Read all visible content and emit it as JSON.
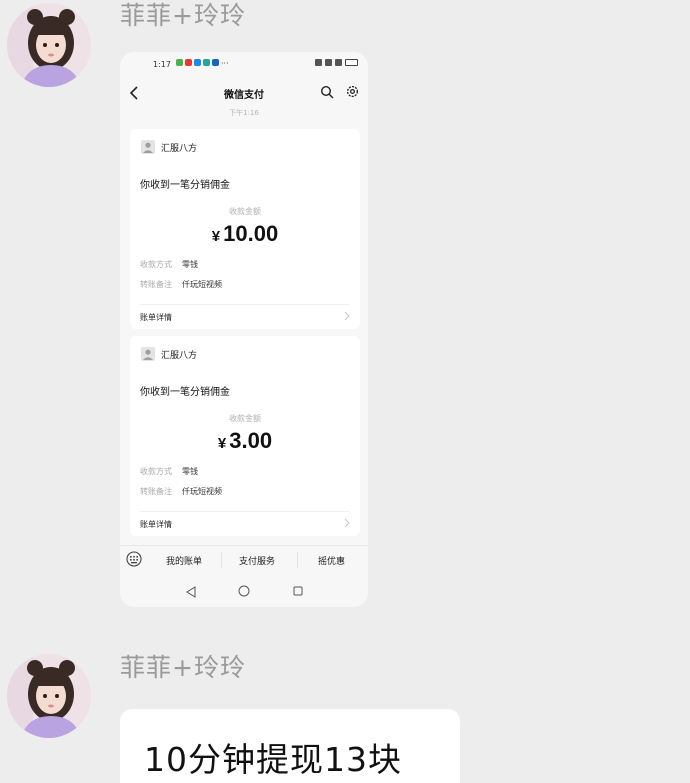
{
  "messages": [
    {
      "sender": "菲菲+玲玲",
      "type": "image"
    },
    {
      "sender": "菲菲+玲玲",
      "type": "text",
      "text": "10分钟提现13块"
    }
  ],
  "screenshot": {
    "status_time": "1:17",
    "status_dots": "···",
    "status_icon_colors": [
      "#4caf50",
      "#e53935",
      "#1e88e5",
      "#26a69a",
      "#1565c0"
    ],
    "nav_title": "微信支付",
    "timestamp": "下午1:16",
    "cards": [
      {
        "merchant": "汇服八方",
        "title": "你收到一笔分销佣金",
        "amount_label": "收款金额",
        "currency": "¥",
        "amount": "10.00",
        "method_label": "收款方式",
        "method_value": "零钱",
        "note_label": "转账备注",
        "note_value": "仟玩短视频",
        "detail_label": "账单详情"
      },
      {
        "merchant": "汇服八方",
        "title": "你收到一笔分销佣金",
        "amount_label": "收款金额",
        "currency": "¥",
        "amount": "3.00",
        "method_label": "收款方式",
        "method_value": "零钱",
        "note_label": "转账备注",
        "note_value": "仟玩短视频",
        "detail_label": "账单详情"
      }
    ],
    "bottom_menu": [
      "我的账单",
      "支付服务",
      "摇优惠"
    ]
  },
  "icons": {
    "back": "chevron-left-icon",
    "search": "search-icon",
    "settings": "gear-icon",
    "keyboard": "keyboard-icon",
    "detail": "chevron-right-icon"
  },
  "colors": {
    "page_bg": "#ededed",
    "sender_name": "#9a9a9a",
    "bubble_bg": "#ffffff"
  }
}
